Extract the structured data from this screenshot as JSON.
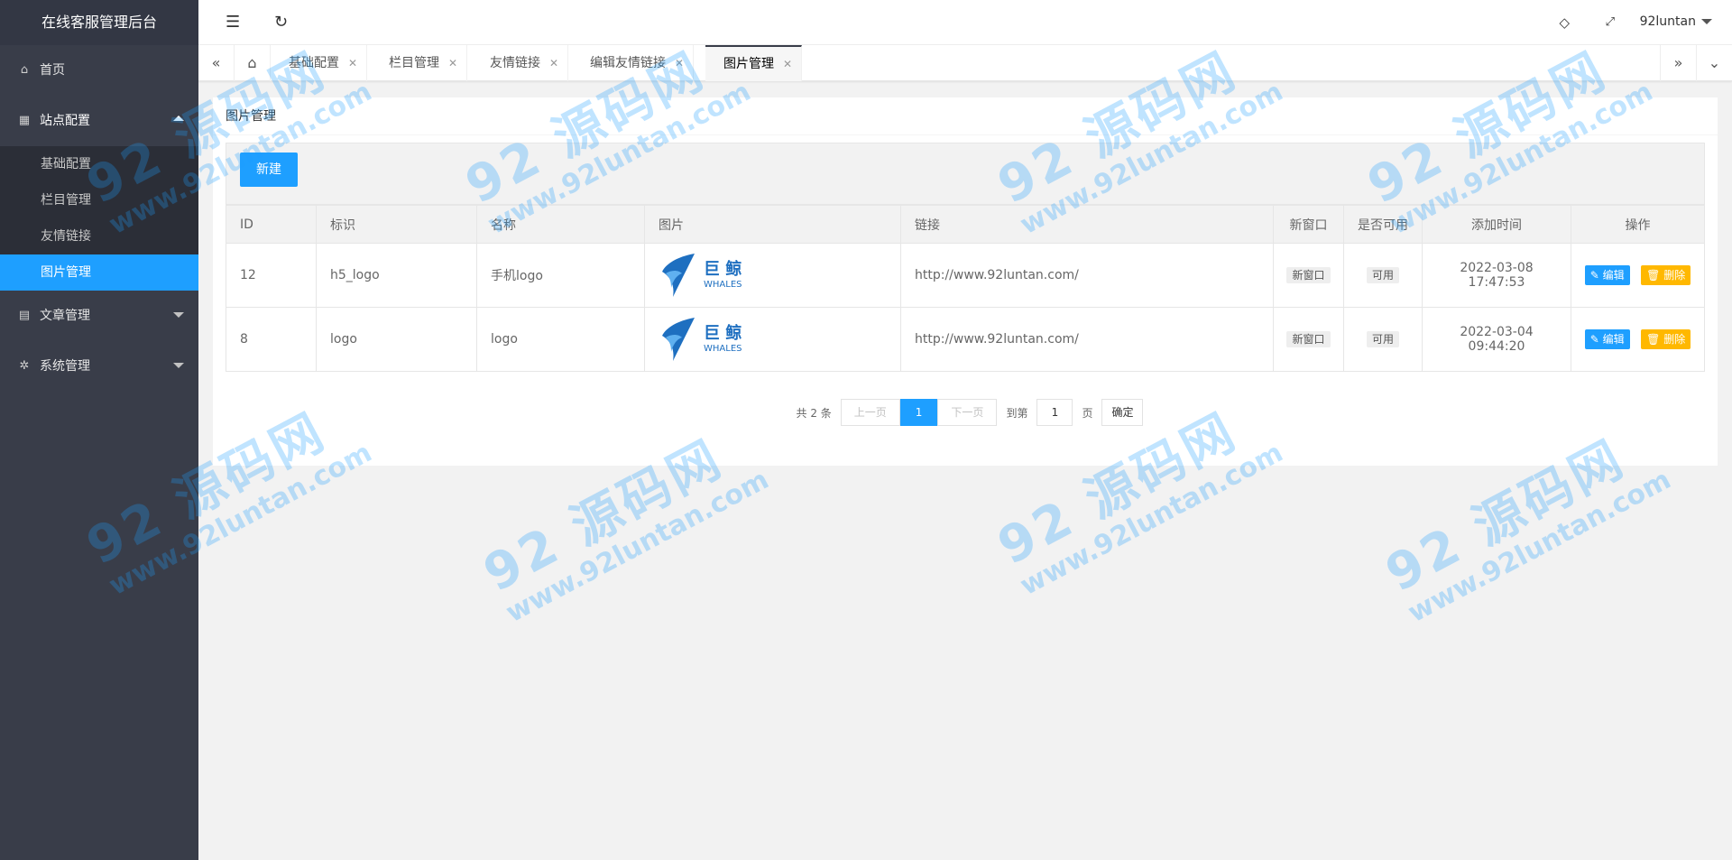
{
  "app": {
    "title": "在线客服管理后台"
  },
  "sidebar": {
    "items": [
      {
        "label": "首页",
        "icon": "home-icon"
      },
      {
        "label": "站点配置",
        "icon": "calendar-icon",
        "expanded": true,
        "children": [
          {
            "label": "基础配置"
          },
          {
            "label": "栏目管理"
          },
          {
            "label": "友情链接"
          },
          {
            "label": "图片管理",
            "active": true
          }
        ]
      },
      {
        "label": "文章管理",
        "icon": "document-icon"
      },
      {
        "label": "系统管理",
        "icon": "gear-icon"
      }
    ]
  },
  "header": {
    "user": "92luntan"
  },
  "tabs": {
    "items": [
      {
        "label": "基础配置"
      },
      {
        "label": "栏目管理"
      },
      {
        "label": "友情链接"
      },
      {
        "label": "编辑友情链接"
      },
      {
        "label": "图片管理",
        "active": true
      }
    ]
  },
  "card": {
    "title": "图片管理",
    "new_button": "新建"
  },
  "table": {
    "columns": [
      "ID",
      "标识",
      "名称",
      "图片",
      "链接",
      "新窗口",
      "是否可用",
      "添加时间",
      "操作"
    ],
    "rows": [
      {
        "id": "12",
        "key": "h5_logo",
        "name": "手机logo",
        "img_text_cn": "巨 鲸",
        "img_text_en": "WHALES",
        "link": "http://www.92luntan.com/",
        "new_window": "新窗口",
        "enabled": "可用",
        "time": "2022-03-08 17:47:53",
        "edit": "编辑",
        "delete": "删除"
      },
      {
        "id": "8",
        "key": "logo",
        "name": "logo",
        "img_text_cn": "巨 鲸",
        "img_text_en": "WHALES",
        "link": "http://www.92luntan.com/",
        "new_window": "新窗口",
        "enabled": "可用",
        "time": "2022-03-04 09:44:20",
        "edit": "编辑",
        "delete": "删除"
      }
    ]
  },
  "pager": {
    "total": "共 2 条",
    "prev": "上一页",
    "current": "1",
    "next": "下一页",
    "goto": "到第",
    "page_input": "1",
    "page_unit": "页",
    "confirm": "确定"
  },
  "watermark": {
    "text": "92 源码网",
    "url": "www.92luntan.com"
  },
  "colors": {
    "sidebar": "#393d49",
    "accent": "#1e9fff",
    "warning": "#ffb800"
  }
}
